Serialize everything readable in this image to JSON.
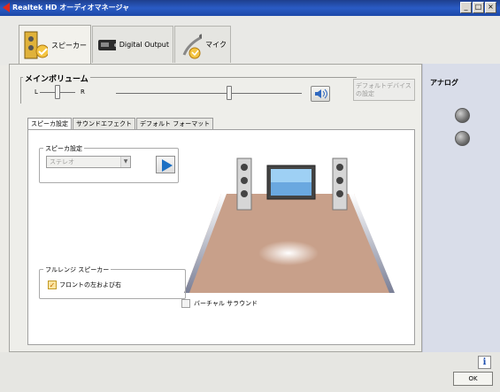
{
  "window": {
    "title": "Realtek HD オーディオマネージャ",
    "controls": {
      "minimize": "_",
      "maximize": "□",
      "close": "×"
    }
  },
  "device_tabs": [
    {
      "label": "スピーカー",
      "icon": "speaker-device-icon",
      "active": true
    },
    {
      "label": "Digital Output",
      "icon": "digital-output-icon",
      "active": false
    },
    {
      "label": "マイク",
      "icon": "microphone-icon",
      "active": false
    }
  ],
  "volume": {
    "title": "メインボリューム",
    "left_label": "L",
    "right_label": "R",
    "balance": 0.5,
    "level": 0.58,
    "mute_icon": "speaker-volume-icon"
  },
  "default_device_button": "デフォルトデバイスの設定",
  "sub_tabs": [
    {
      "label": "スピーカ設定",
      "active": true
    },
    {
      "label": "サウンドエフェクト",
      "active": false
    },
    {
      "label": "デフォルト フォーマット",
      "active": false
    }
  ],
  "speaker_config": {
    "group_label": "スピーカ設定",
    "selected": "ステレオ",
    "play_icon": "play-icon"
  },
  "fullrange": {
    "group_label": "フルレンジ スピーカー",
    "front_label": "フロントの左および右",
    "front_checked": true
  },
  "virtual_surround": {
    "label": "バーチャル サラウンド",
    "checked": false
  },
  "analog": {
    "title": "アナログ",
    "jacks": [
      "jack-1",
      "jack-2"
    ]
  },
  "footer": {
    "info": "i",
    "ok": "OK"
  },
  "colors": {
    "titlebar": "#2a5bc4",
    "accent_play": "#1d70c4",
    "room_floor": "#c8a08a",
    "analog_panel": "#d9dde9"
  }
}
